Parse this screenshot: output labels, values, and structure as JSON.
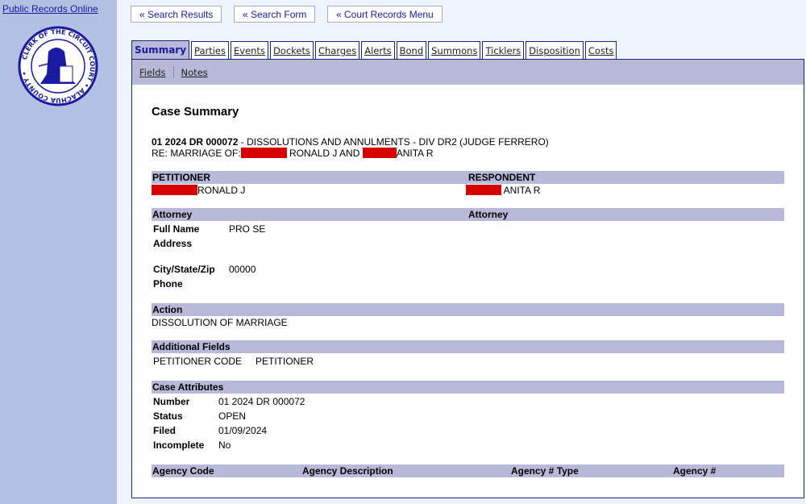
{
  "sidebar": {
    "link": "Public Records Online",
    "seal_text": "CLERK OF THE CIRCUIT COURT • ALACHUA COUNTY •"
  },
  "nav": {
    "search_results": "« Search Results",
    "search_form": "« Search Form",
    "court_menu": "« Court Records Menu"
  },
  "tabs": [
    "Summary",
    "Parties",
    "Events",
    "Dockets",
    "Charges",
    "Alerts",
    "Bond",
    "Summons",
    "Ticklers",
    "Disposition",
    "Costs"
  ],
  "subnav": [
    "Fields",
    "Notes"
  ],
  "summary": {
    "title": "Case Summary",
    "case_number": "01 2024 DR 000072",
    "case_desc": " - DISSOLUTIONS AND ANNULMENTS - DIV DR2 (JUDGE FERRERO)",
    "re_prefix": "RE: MARRIAGE OF:",
    "re_mid": " RONALD J AND ",
    "re_end": "ANITA R",
    "petitioner_header": "PETITIONER",
    "respondent_header": "RESPONDENT",
    "petitioner_name": "RONALD J",
    "respondent_name": "ANITA R",
    "attorney_header": "Attorney",
    "attorney_header_right": "Attorney",
    "full_name_label": "Full Name",
    "full_name": "PRO SE",
    "address_label": "Address",
    "city_label": "City/State/Zip",
    "city": "00000",
    "phone_label": "Phone",
    "action_header": "Action",
    "action": "DISSOLUTION OF MARRIAGE",
    "additional_header": "Additional Fields",
    "add_label": "PETITIONER CODE",
    "add_value": "PETITIONER",
    "attributes_header": "Case Attributes",
    "attributes": [
      [
        "Number",
        "01 2024 DR 000072"
      ],
      [
        "Status",
        "OPEN"
      ],
      [
        "Filed",
        "01/09/2024"
      ],
      [
        "Incomplete",
        "No"
      ]
    ],
    "agency_cols": [
      "Agency Code",
      "Agency Description",
      "Agency # Type",
      "Agency #"
    ]
  },
  "colors": {
    "sidebar": "#b3bfe3",
    "header_bar": "#b8b8d8",
    "navy": "#1a237e",
    "redaction": "#d50000"
  }
}
